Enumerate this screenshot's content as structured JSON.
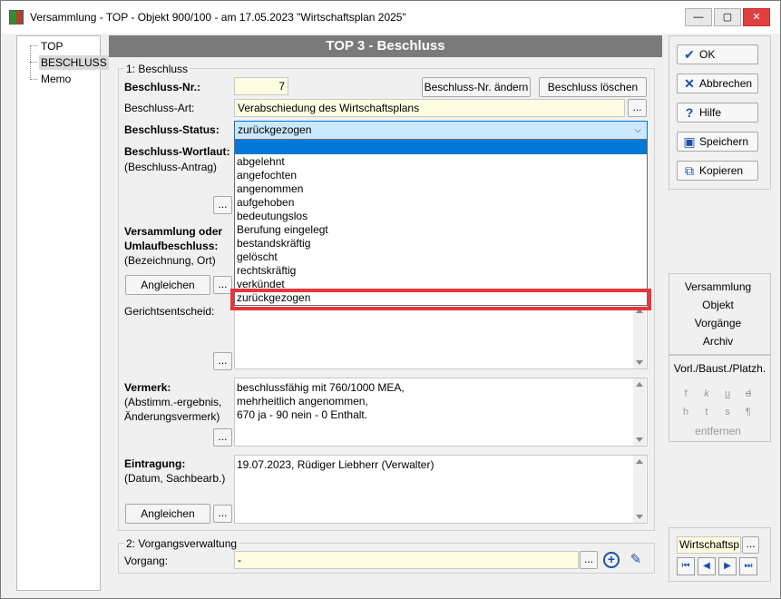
{
  "window": {
    "title": "Versammlung - TOP - Objekt 900/100 - am 17.05.2023 \"Wirtschaftsplan 2025\"",
    "min": "—",
    "max": "▢",
    "close": "✕"
  },
  "tree": {
    "items": [
      "TOP",
      "BESCHLUSS",
      "Memo"
    ],
    "selected": "BESCHLUSS"
  },
  "header": "TOP 3 - Beschluss",
  "section1": {
    "title": "1: Beschluss"
  },
  "fields": {
    "nr_label": "Beschluss-Nr.:",
    "nr_value": "7",
    "nr_change": "Beschluss-Nr. ändern",
    "delete": "Beschluss löschen",
    "art_label": "Beschluss-Art:",
    "art_value": "Verabschiedung des Wirtschaftsplans",
    "status_label": "Beschluss-Status:",
    "status_value": "zurückgezogen",
    "wortlaut_label": "Beschluss-Wortlaut:",
    "wortlaut_sub": "(Beschluss-Antrag)",
    "versammlung_label1": "Versammlung oder",
    "versammlung_label2": "Umlaufbeschluss:",
    "versammlung_sub": "(Bezeichnung, Ort)",
    "angleichen": "Angleichen",
    "gericht_label": "Gerichtsentscheid:",
    "vermerk_label": "Vermerk:",
    "vermerk_sub1": "(Abstimm.-ergebnis,",
    "vermerk_sub2": "Änderungsvermerk)",
    "vermerk_value": "beschlussfähig mit 760/1000 MEA,\nmehrheitlich angenommen,\n670 ja -  90 nein -  0 Enthalt.",
    "eintragung_label": "Eintragung:",
    "eintragung_sub": "(Datum, Sachbearb.)",
    "eintragung_value": "19.07.2023, Rüdiger Liebherr (Verwalter)",
    "ellipsis": "..."
  },
  "dropdown": {
    "options": [
      "",
      "abgelehnt",
      "angefochten",
      "angenommen",
      "aufgehoben",
      "bedeutungslos",
      "Berufung eingelegt",
      "bestandskräftig",
      "gelöscht",
      "rechtskräftig",
      "verkündet",
      "zurückgezogen"
    ]
  },
  "section2": {
    "title": "2: Vorgangsverwaltung",
    "vorgang_label": "Vorgang:",
    "vorgang_value": "-"
  },
  "right": {
    "ok": "OK",
    "cancel": "Abbrechen",
    "help": "Hilfe",
    "save": "Speichern",
    "copy": "Kopieren",
    "links": [
      "Versammlung",
      "Objekt",
      "Vorgänge",
      "Archiv"
    ],
    "vorl": "Vorl./Baust./Platzh.",
    "fmt1": [
      "f",
      "k",
      "u",
      "d"
    ],
    "fmt2": [
      "h",
      "t",
      "s",
      "¶"
    ],
    "entfernen": "entfernen",
    "wp": "Wirtschaftsp",
    "wp_btn": "..."
  },
  "colors": {
    "header": "#7a7a7a",
    "field": "#fffde1",
    "highlight": "#0078d7",
    "annotation": "#e8353c"
  }
}
